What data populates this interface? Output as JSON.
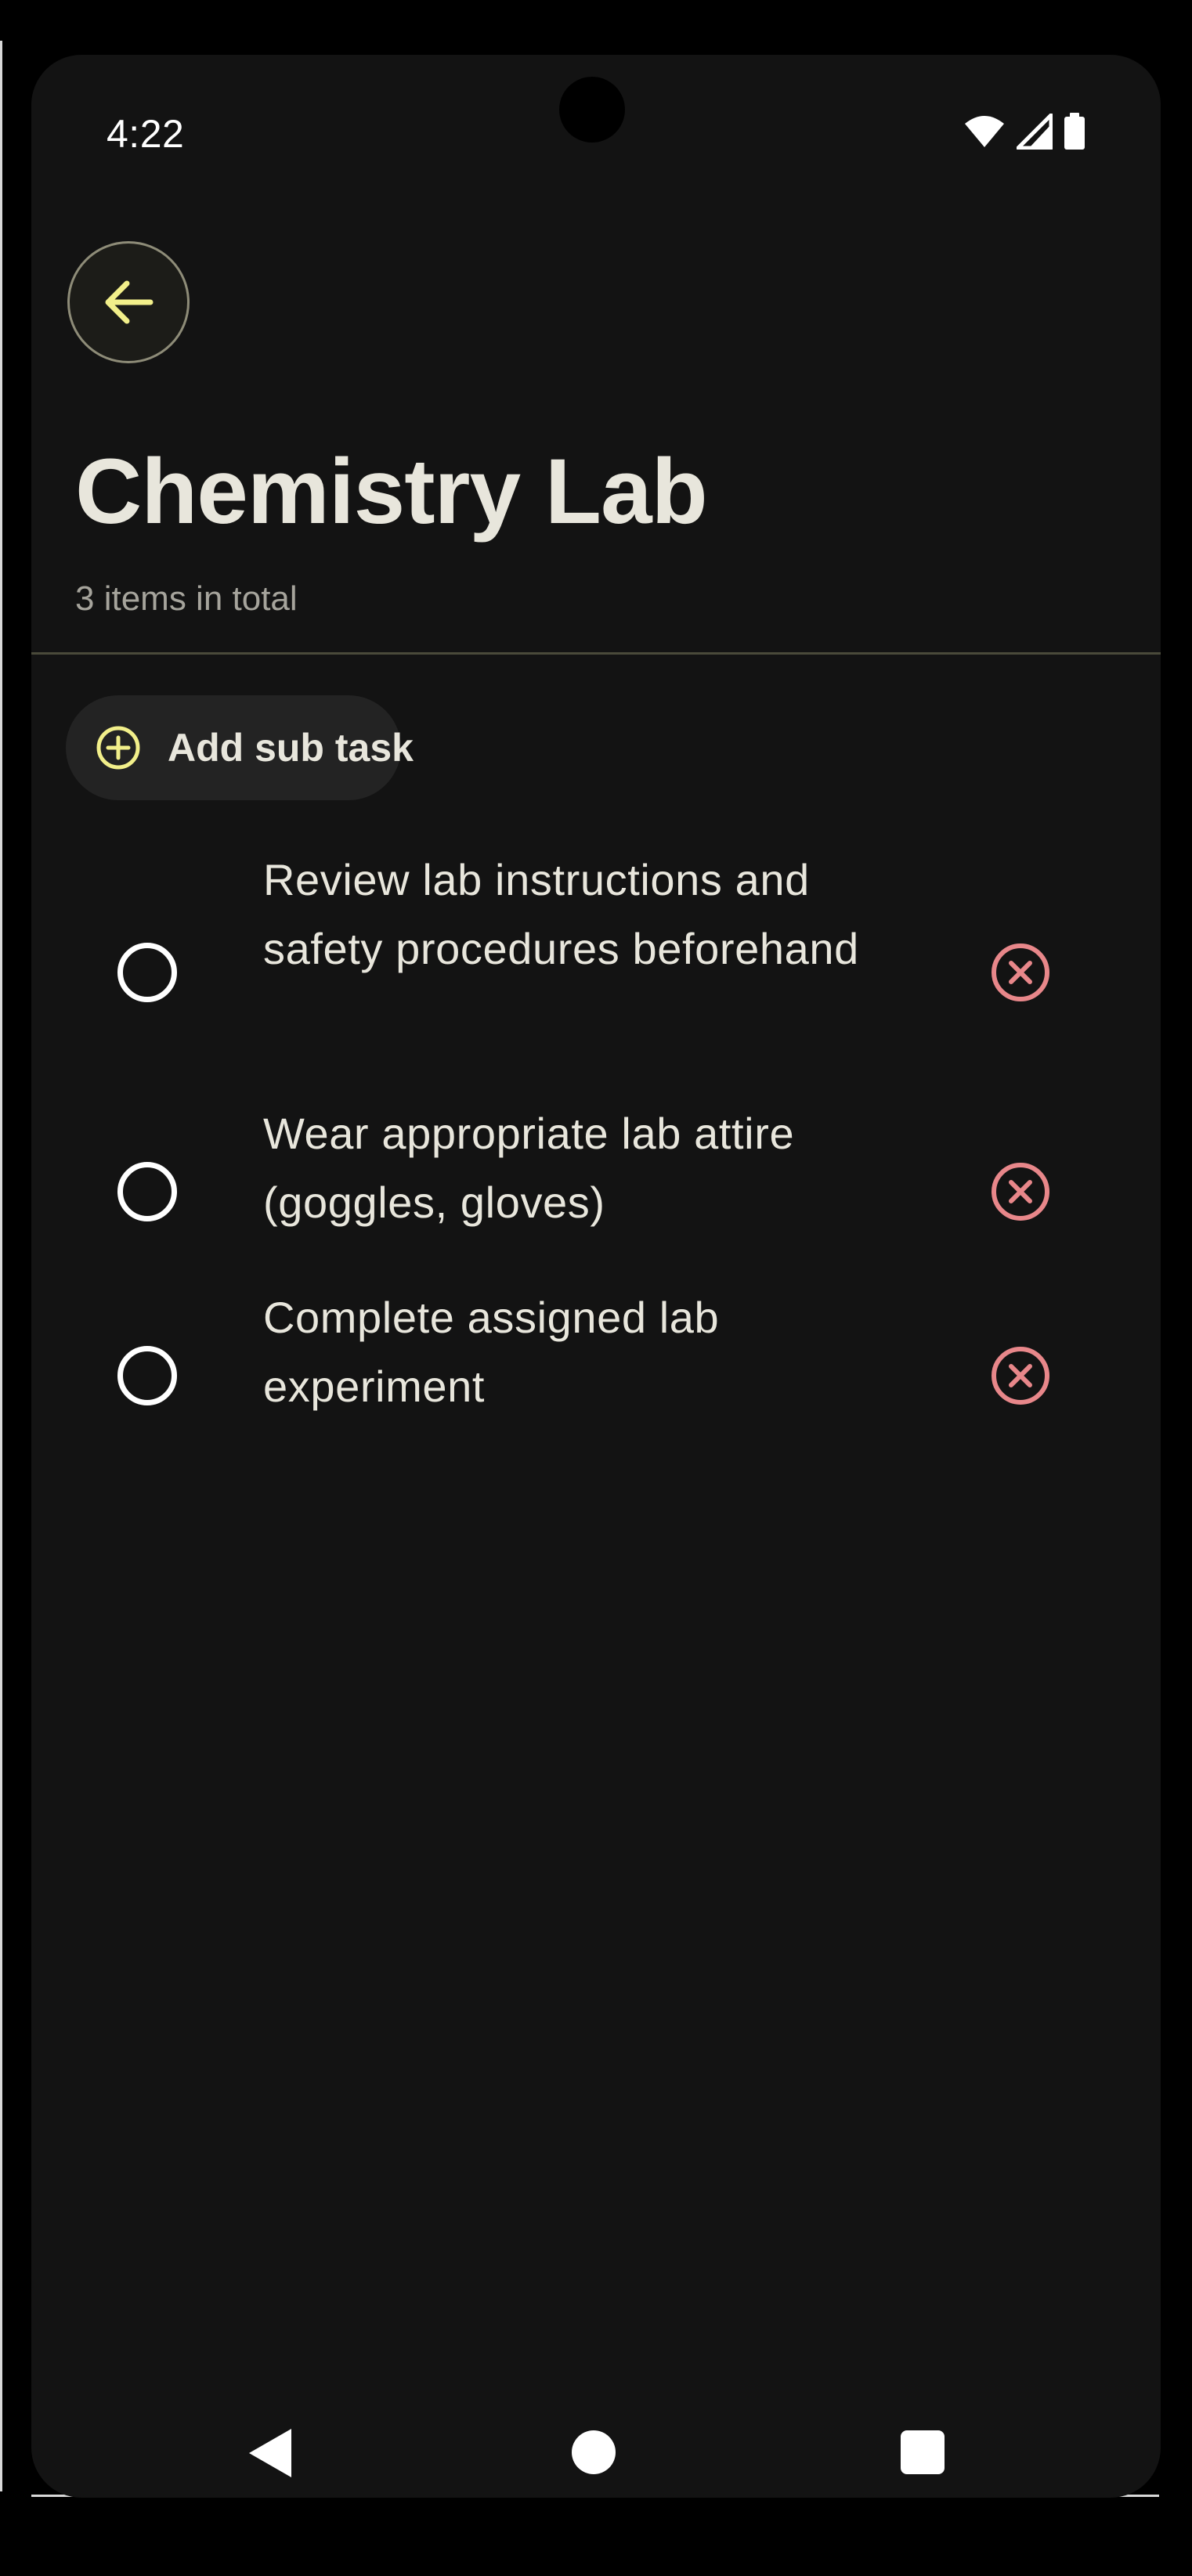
{
  "status_bar": {
    "time": "4:22",
    "icons": [
      "wifi-icon",
      "cellular-signal-icon",
      "battery-icon"
    ]
  },
  "header": {
    "back_icon": "arrow-left-icon",
    "title": "Chemistry Lab",
    "subtitle": "3 items in total"
  },
  "add_subtask": {
    "icon": "plus-circle-icon",
    "label": "Add sub task"
  },
  "tasks": [
    {
      "text": "Review lab instructions and safety procedures beforehand",
      "completed": false
    },
    {
      "text": "Wear appropriate lab attire (goggles, gloves)",
      "completed": false
    },
    {
      "text": "Complete assigned lab experiment",
      "completed": false
    }
  ],
  "nav_bar": {
    "icons": [
      "nav-back-icon",
      "nav-home-icon",
      "nav-recents-icon"
    ]
  },
  "colors": {
    "background": "#131313",
    "accent": "#f2ef8a",
    "remove": "#e8878a",
    "text": "#e8e6dc"
  }
}
